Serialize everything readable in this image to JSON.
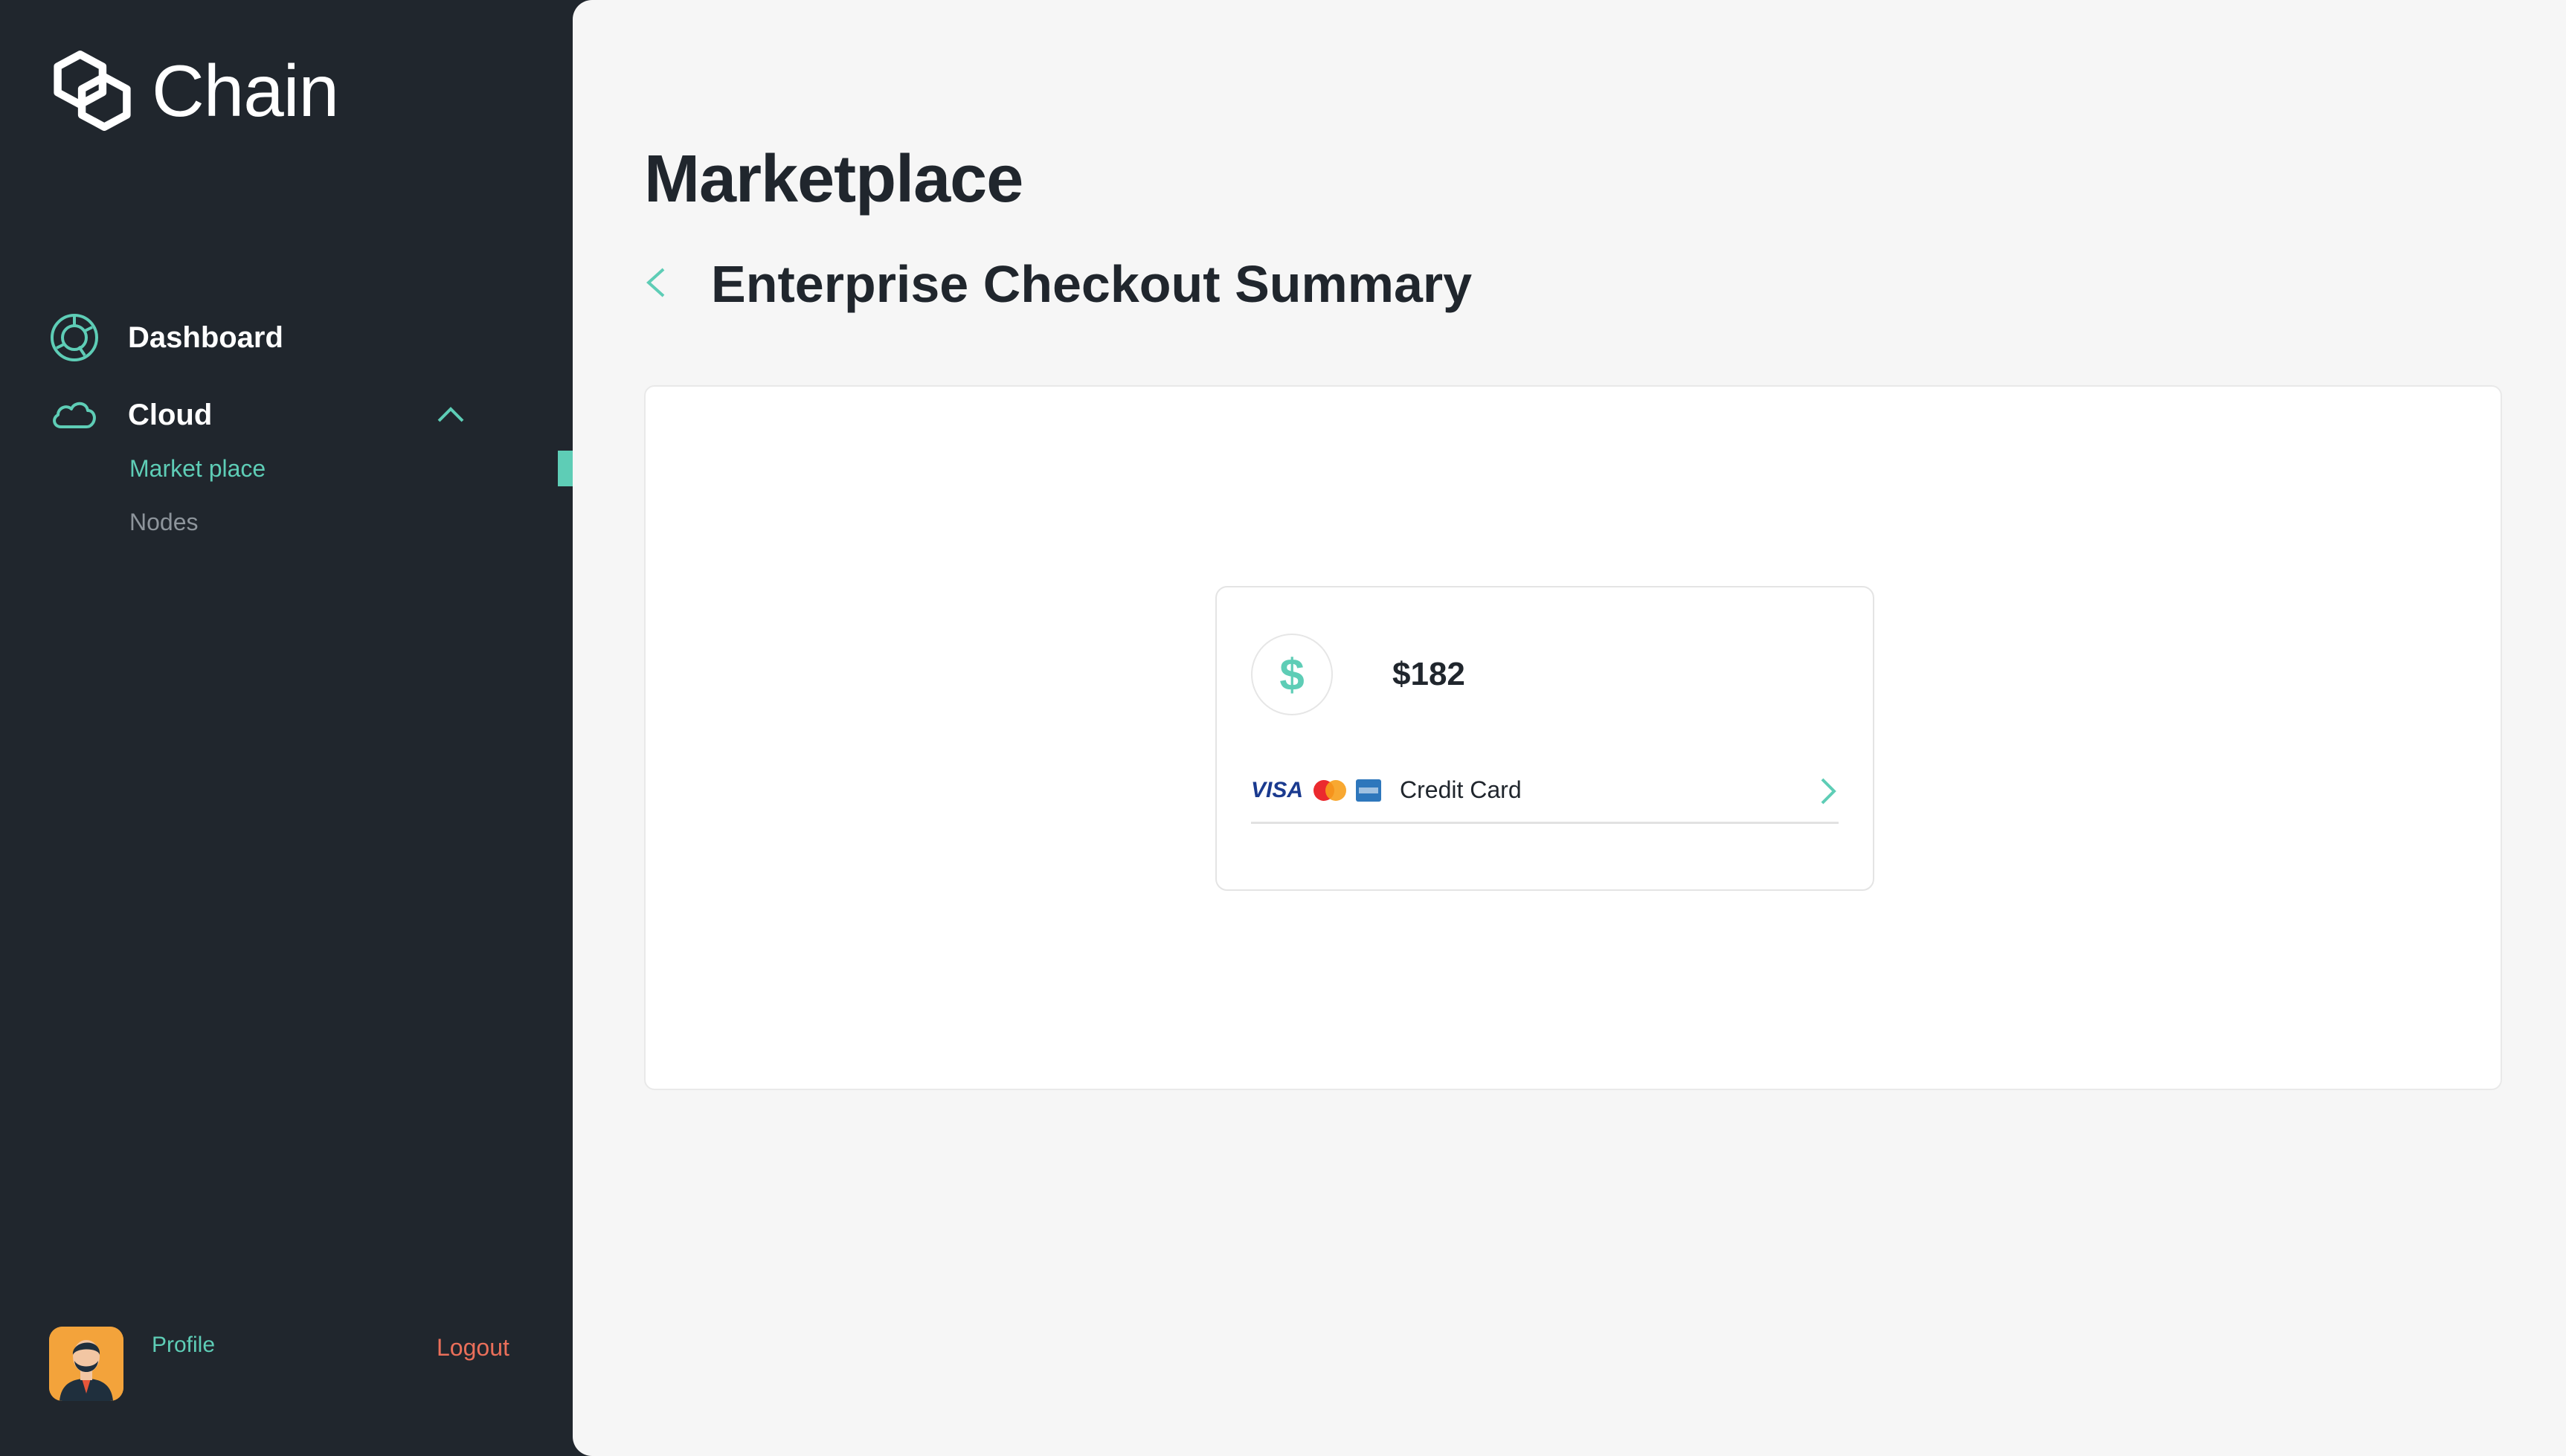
{
  "app": {
    "name": "Chain"
  },
  "colors": {
    "accent": "#5ecdb6",
    "sidebar_bg": "#20262d",
    "logout": "#ea6f5a"
  },
  "sidebar": {
    "items": [
      {
        "label": "Dashboard",
        "icon": "dashboard-icon"
      },
      {
        "label": "Cloud",
        "icon": "cloud-icon",
        "expanded": true
      }
    ],
    "sub_items": [
      {
        "label": "Market place",
        "active": true
      },
      {
        "label": "Nodes",
        "active": false
      }
    ],
    "footer": {
      "profile_label": "Profile",
      "logout_label": "Logout"
    }
  },
  "main": {
    "title": "Marketplace",
    "subtitle": "Enterprise Checkout Summary",
    "summary": {
      "amount": "$182",
      "currency_symbol": "$",
      "payment_method": "Credit Card",
      "card_brands": [
        "VISA",
        "Mastercard",
        "American Express"
      ]
    }
  }
}
